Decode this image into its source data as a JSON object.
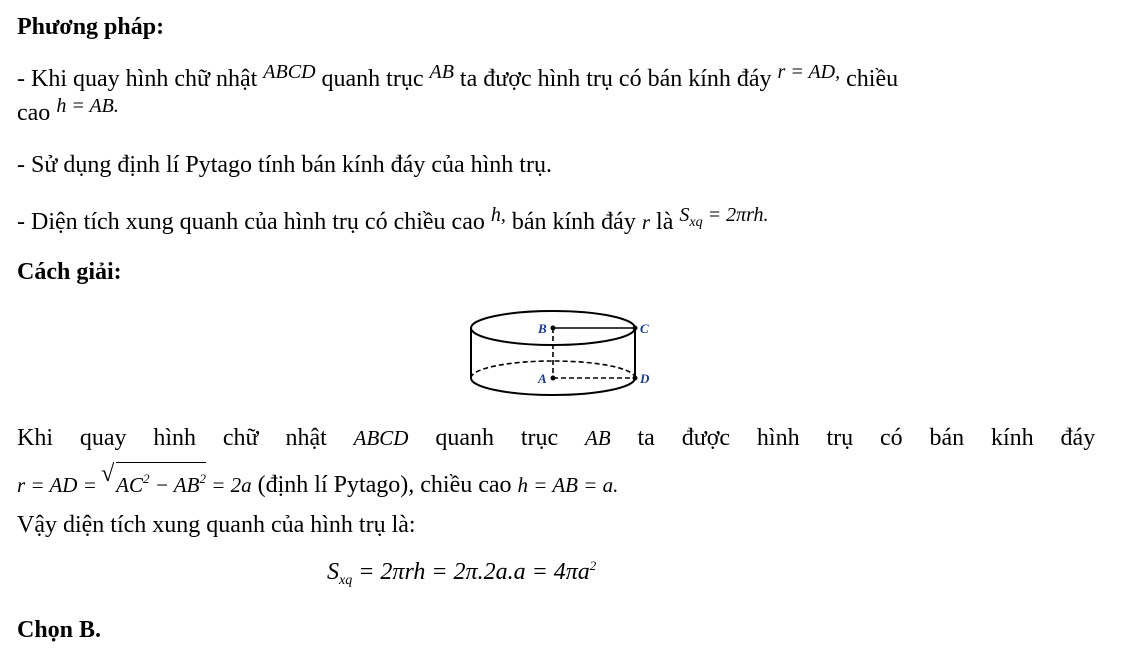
{
  "method": {
    "heading": "Phương pháp:",
    "bullet1": {
      "prefix": "- Khi quay hình chữ nhật ",
      "rect": "ABCD",
      "mid1": " quanh trục ",
      "axis": "AB",
      "mid2": " ta được hình trụ có bán kính đáy ",
      "radius_expr": "r = AD,",
      "mid3": " chiều",
      "line2_prefix": "cao ",
      "height_expr": "h = AB."
    },
    "bullet2": "- Sử dụng định lí Pytago tính bán kính đáy của hình trụ.",
    "bullet3": {
      "prefix": "- Diện tích xung quanh của hình trụ có chiều cao ",
      "h": "h,",
      "mid": " bán kính đáy ",
      "r": "r",
      "mid2": " là ",
      "S": "S",
      "sub": "xq",
      "formula": " = 2πrh."
    }
  },
  "solution": {
    "heading": "Cách giải:",
    "figure": {
      "labels": {
        "B": "B",
        "C": "C",
        "A": "A",
        "D": "D"
      },
      "line_color": "#000000",
      "label_color": "#1a3a8c"
    },
    "para1": {
      "words": [
        "Khi",
        "quay",
        "hình",
        "chữ",
        "nhật",
        "ABCD",
        "quanh",
        "trục",
        "AB",
        "ta",
        "được",
        "hình",
        "trụ",
        "có",
        "bán",
        "kính",
        "đáy"
      ],
      "line2": {
        "r_expr": "r = AD = ",
        "sqrt_a": "AC",
        "sqrt_exp1": "2",
        "sqrt_minus": " − AB",
        "sqrt_exp2": "2",
        "after_sqrt": " = 2a",
        "text": " (định lí Pytago), chiều cao ",
        "h_expr": "h = AB = a."
      }
    },
    "para2": "Vậy diện tích xung quanh của hình trụ là:",
    "formula": {
      "S": "S",
      "sub": "xq",
      "body": " = 2πrh = 2π.2a.a = 4πa",
      "exp": "2"
    },
    "answer": "Chọn B."
  }
}
